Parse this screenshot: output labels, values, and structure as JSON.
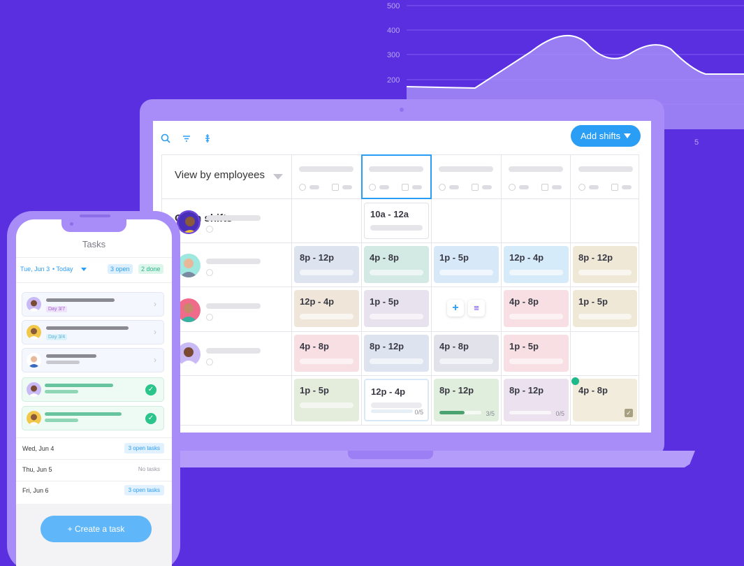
{
  "background_chart": {
    "y_ticks": [
      "500",
      "400",
      "300",
      "200"
    ],
    "x_tick": "5"
  },
  "schedule": {
    "add_shifts_label": "Add shifts",
    "view_by_label": "View by employees",
    "open_shifts_label": "Open shifts",
    "open_shift_time": "10a - 12a",
    "rows": [
      [
        "8p - 12p",
        "4p - 8p",
        "1p - 5p",
        "12p - 4p",
        "8p - 12p"
      ],
      [
        "12p - 4p",
        "1p - 5p",
        "",
        "4p - 8p",
        "1p - 5p"
      ],
      [
        "4p - 8p",
        "8p - 12p",
        "4p - 8p",
        "1p - 5p",
        ""
      ],
      [
        "1p - 5p",
        "12p - 4p",
        "8p - 12p",
        "8p - 12p",
        "4p - 8p"
      ]
    ],
    "progress": [
      {
        "label": "0/5",
        "value": 0
      },
      {
        "label": "3/5",
        "value": 0.6
      },
      {
        "label": "0/5",
        "value": 0
      }
    ],
    "colors": {
      "blue": "#dde4ef",
      "teal": "#d3e9e3",
      "lightblue": "#d7e9f9",
      "sky": "#d6ebf9",
      "tan": "#f0e8d6",
      "beige": "#efe6d9",
      "lilac": "#e7e2ee",
      "pink": "#f7dfe3",
      "sage": "#e4ecdc",
      "mauve": "#ece1ee",
      "accent": "#2a9df4"
    }
  },
  "phone": {
    "title": "Tasks",
    "date": "Tue, Jun 3",
    "today": "• Today",
    "open_badge": "3 open",
    "done_badge": "2 done",
    "task_badges": [
      "Day 3/7",
      "Day 3/4"
    ],
    "days": [
      {
        "day": "Wed, Jun 4",
        "status": "3 open tasks"
      },
      {
        "day": "Thu, Jun 5",
        "status": "No tasks"
      },
      {
        "day": "Fri, Jun 6",
        "status": "3 open tasks"
      }
    ],
    "create_label": "+ Create a task"
  }
}
